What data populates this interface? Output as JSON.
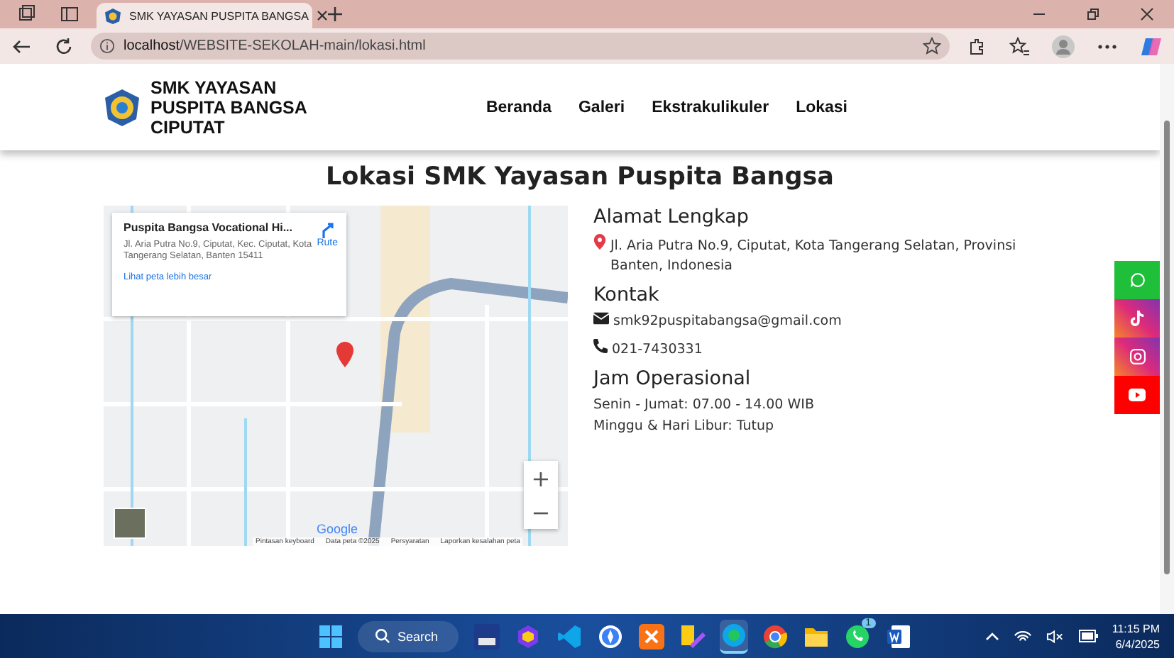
{
  "browser": {
    "tabs": [
      {
        "title": "SMK YAYASAN PUSPITA BANGSA",
        "selected": true
      }
    ],
    "url": {
      "host": "localhost",
      "path": "/WEBSITE-SEKOLAH-main/lokasi.html"
    }
  },
  "site": {
    "brand": [
      "SMK YAYASAN",
      "PUSPITA BANGSA",
      "CIPUTAT"
    ],
    "nav": [
      "Beranda",
      "Galeri",
      "Ekstrakulikuler",
      "Lokasi"
    ]
  },
  "heading": "Lokasi SMK Yayasan Puspita Bangsa",
  "map": {
    "card": {
      "title": "Puspita Bangsa Vocational Hi...",
      "address": "Jl. Aria Putra No.9, Ciputat, Kec. Ciputat, Kota Tangerang Selatan, Banten 15411",
      "directions": "Rute",
      "link": "Lihat peta lebih besar"
    },
    "zoom_in": "+",
    "zoom_out": "−",
    "logo": "Google",
    "footer": [
      "Pintasan keyboard",
      "Data peta ©2025",
      "Persyaratan",
      "Laporkan kesalahan peta"
    ]
  },
  "info": [
    {
      "heading": "Alamat Lengkap",
      "lines": [
        {
          "kind": "address",
          "text": "Jl. Aria Putra No.9, Ciputat, Kota Tangerang Selatan, Provinsi Banten, Indonesia"
        }
      ]
    },
    {
      "heading": "Kontak",
      "lines": [
        {
          "kind": "email",
          "text": "smk92puspitabangsa@gmail.com"
        },
        {
          "kind": "phone",
          "text": "021-7430331"
        }
      ]
    },
    {
      "heading": "Jam Operasional",
      "lines": [
        {
          "kind": "plain",
          "text": "Senin - Jumat: 07.00 - 14.00 WIB"
        },
        {
          "kind": "plain",
          "text": "Minggu & Hari Libur: Tutup"
        }
      ]
    }
  ],
  "social": [
    {
      "kind": "whatsapp"
    },
    {
      "kind": "tiktok"
    },
    {
      "kind": "instagram"
    },
    {
      "kind": "youtube"
    }
  ],
  "taskbar": {
    "search": "Search",
    "apps": [
      {
        "kind": "devc",
        "active": false
      },
      {
        "kind": "box",
        "active": false
      },
      {
        "kind": "vscode",
        "active": false
      },
      {
        "kind": "compass",
        "active": false
      },
      {
        "kind": "xampp",
        "active": false
      },
      {
        "kind": "editor",
        "active": false
      },
      {
        "kind": "edge",
        "active": true
      },
      {
        "kind": "chrome",
        "active": false
      },
      {
        "kind": "folder",
        "active": false
      },
      {
        "kind": "whatsapp",
        "active": false,
        "badge": "1"
      },
      {
        "kind": "word",
        "active": false
      }
    ],
    "time": "11:15 PM",
    "date": "6/4/2025"
  }
}
